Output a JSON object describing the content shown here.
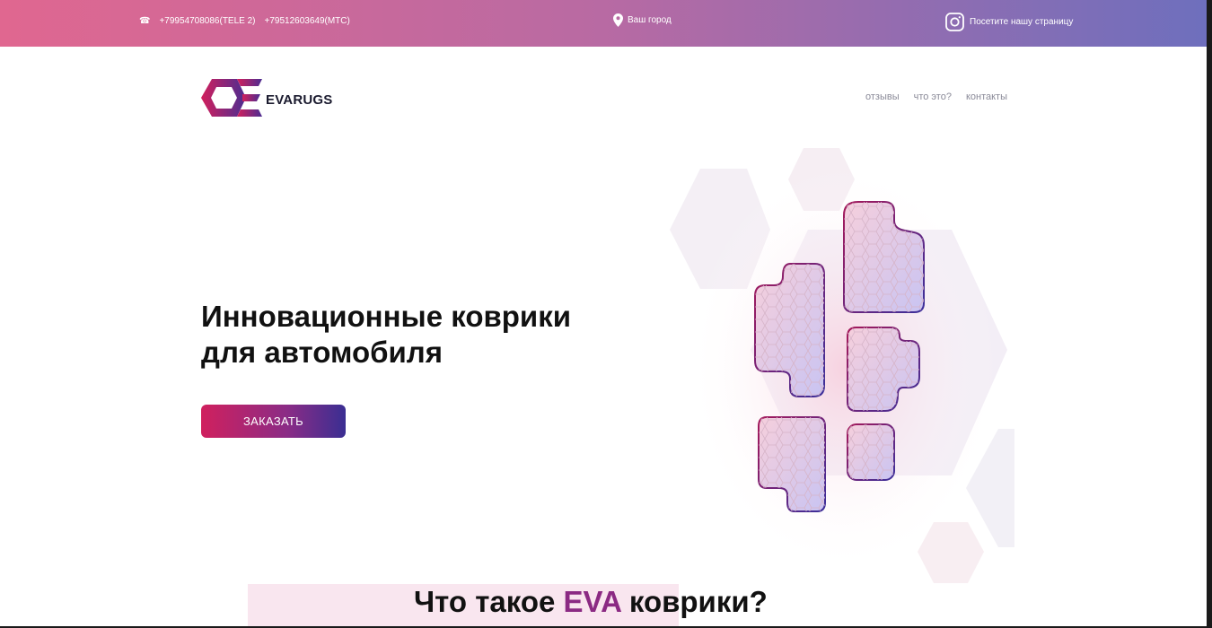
{
  "topbar": {
    "phone_1": "+79954708086(TELE 2)",
    "phone_2": "+79512603649(MTC)",
    "city": "Ваш город",
    "instagram_label": "Посетите нашу страницу",
    "gradient_start": "#e06790",
    "gradient_end": "#6e6fbd"
  },
  "header": {
    "logo_text": "EVARUGS",
    "nav": [
      "отзывы",
      "что это?",
      "контакты"
    ]
  },
  "hero": {
    "title_line_1": "Инновационные коврики",
    "title_line_2": "для автомобиля",
    "order_button": "ЗАКАЗАТЬ",
    "image_icon": "car-floor-mats-illustration"
  },
  "section": {
    "title_before": "Что такое ",
    "title_accent": "EVA",
    "title_after": " коврики?",
    "accent_color": "#8b2a83"
  },
  "icons": {
    "phone": "phone-icon",
    "location": "location-pin-icon",
    "instagram": "instagram-icon"
  }
}
